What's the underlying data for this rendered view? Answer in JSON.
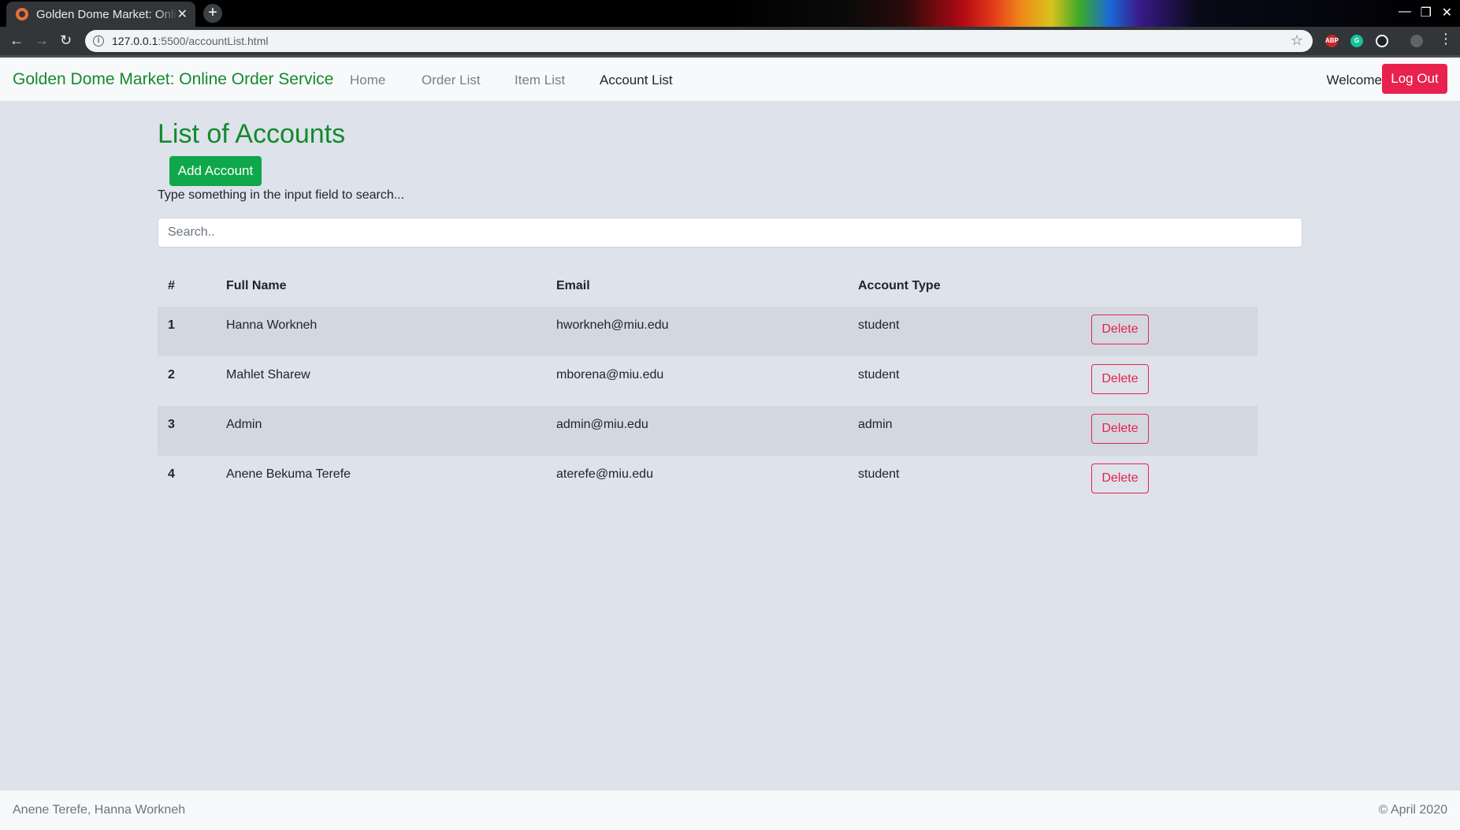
{
  "browser": {
    "tab_title": "Golden Dome Market: Online Order Service",
    "url_host": "127.0.0.1",
    "url_path": ":5500/accountList.html"
  },
  "navbar": {
    "brand": "Golden Dome Market: Online Order Service",
    "links": [
      "Home",
      "Order List",
      "Item List",
      "Account List"
    ],
    "active": "Account List",
    "welcome": "Welcome",
    "logout": "Log Out"
  },
  "main": {
    "title": "List of Accounts",
    "add_button": "Add Account",
    "hint": "Type something in the input field to search...",
    "search_placeholder": "Search.."
  },
  "table": {
    "headers": [
      "#",
      "Full Name",
      "Email",
      "Account Type",
      ""
    ],
    "rows": [
      {
        "num": "1",
        "name": "Hanna Workneh",
        "email": "hworkneh@miu.edu",
        "type": "student",
        "action": "Delete"
      },
      {
        "num": "2",
        "name": "Mahlet Sharew",
        "email": "mborena@miu.edu",
        "type": "student",
        "action": "Delete"
      },
      {
        "num": "3",
        "name": "Admin",
        "email": "admin@miu.edu",
        "type": "admin",
        "action": "Delete"
      },
      {
        "num": "4",
        "name": "Anene Bekuma Terefe",
        "email": "aterefe@miu.edu",
        "type": "student",
        "action": "Delete"
      }
    ]
  },
  "footer": {
    "authors": "Anene Terefe, Hanna Workneh",
    "copyright": "© April 2020"
  },
  "colors": {
    "brand_green": "#138a2e",
    "button_green": "#0ea84a",
    "danger": "#e8214f",
    "background": "#dee2ea"
  }
}
